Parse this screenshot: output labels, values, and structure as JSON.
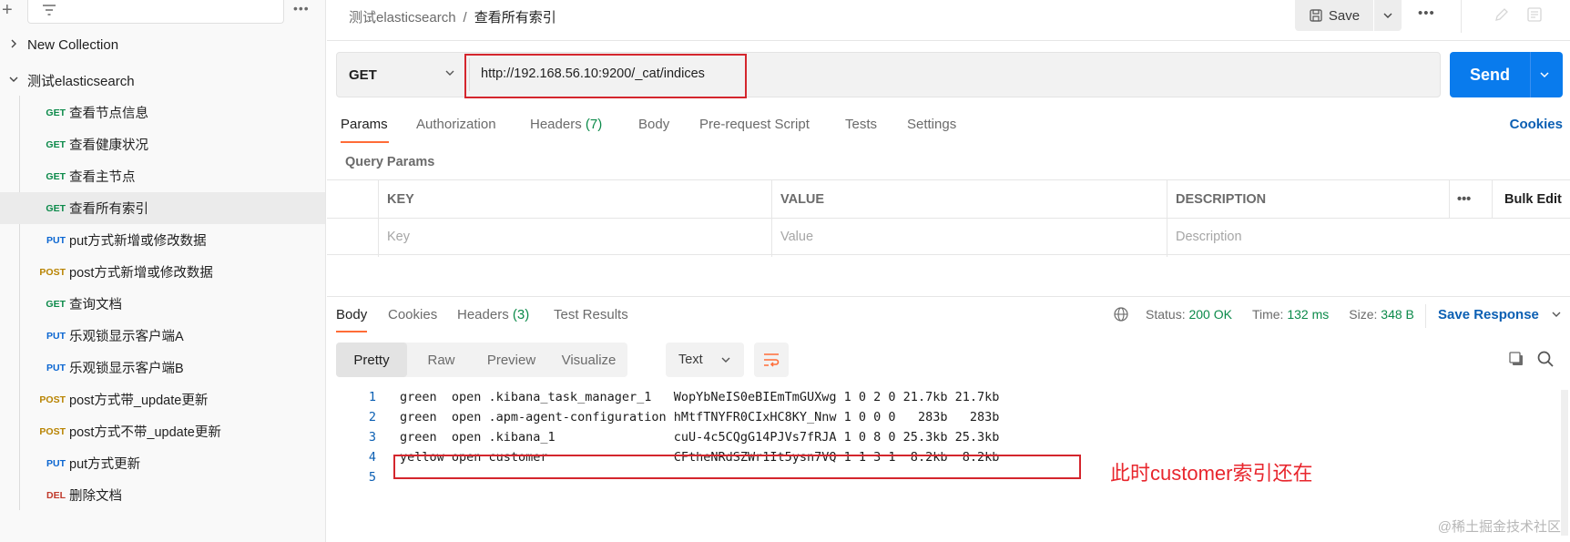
{
  "sidebar": {
    "collections": [
      {
        "name": "New Collection",
        "expanded": false
      },
      {
        "name": "测试elasticsearch",
        "expanded": true
      }
    ],
    "requests": [
      {
        "method": "GET",
        "name": "查看节点信息"
      },
      {
        "method": "GET",
        "name": "查看健康状况"
      },
      {
        "method": "GET",
        "name": "查看主节点"
      },
      {
        "method": "GET",
        "name": "查看所有索引"
      },
      {
        "method": "PUT",
        "name": "put方式新增或修改数据"
      },
      {
        "method": "POST",
        "name": "post方式新增或修改数据"
      },
      {
        "method": "GET",
        "name": "查询文档"
      },
      {
        "method": "PUT",
        "name": "乐观锁显示客户端A"
      },
      {
        "method": "PUT",
        "name": "乐观锁显示客户端B"
      },
      {
        "method": "POST",
        "name": "post方式带_update更新"
      },
      {
        "method": "POST",
        "name": "post方式不带_update更新"
      },
      {
        "method": "PUT",
        "name": "put方式更新"
      },
      {
        "method": "DEL",
        "name": "删除文档"
      }
    ]
  },
  "header": {
    "breadcrumb_collection": "测试elasticsearch",
    "breadcrumb_separator": "/",
    "breadcrumb_request": "查看所有索引",
    "save_label": "Save"
  },
  "request": {
    "method": "GET",
    "url": "http://192.168.56.10:9200/_cat/indices",
    "send_label": "Send"
  },
  "request_tabs": {
    "params": "Params",
    "authorization": "Authorization",
    "headers": "Headers",
    "headers_count": "(7)",
    "body": "Body",
    "prerequest": "Pre-request Script",
    "tests": "Tests",
    "settings": "Settings",
    "cookies": "Cookies"
  },
  "query_params": {
    "title": "Query Params",
    "col_key": "KEY",
    "col_value": "VALUE",
    "col_description": "DESCRIPTION",
    "bulk_edit": "Bulk Edit",
    "ph_key": "Key",
    "ph_value": "Value",
    "ph_description": "Description"
  },
  "response_tabs": {
    "body": "Body",
    "cookies": "Cookies",
    "headers": "Headers",
    "headers_count": "(3)",
    "test_results": "Test Results"
  },
  "response_status": {
    "status_label": "Status:",
    "status_value": "200 OK",
    "time_label": "Time:",
    "time_value": "132 ms",
    "size_label": "Size:",
    "size_value": "348 B",
    "save_response": "Save Response"
  },
  "view": {
    "pretty": "Pretty",
    "raw": "Raw",
    "preview": "Preview",
    "visualize": "Visualize",
    "format": "Text"
  },
  "code_lines": [
    {
      "n": "1",
      "text": "green  open .kibana_task_manager_1   WopYbNeIS0eBIEmTmGUXwg 1 0 2 0 21.7kb 21.7kb"
    },
    {
      "n": "2",
      "text": "green  open .apm-agent-configuration hMtfTNYFR0CIxHC8KY_Nnw 1 0 0 0   283b   283b"
    },
    {
      "n": "3",
      "text": "green  open .kibana_1                cuU-4c5CQgG14PJVs7fRJA 1 0 8 0 25.3kb 25.3kb"
    },
    {
      "n": "4",
      "text": "yellow open customer                 CFtheNRdSZWr1It5ysn7VQ 1 1 3 1  8.2kb  8.2kb"
    },
    {
      "n": "5",
      "text": ""
    }
  ],
  "annotation": "此时customer索引还在",
  "watermark": "@稀土掘金技术社区",
  "colors": {
    "accent": "#ff6c37",
    "send": "#097bed",
    "highlight": "#d4262d",
    "get": "#0c8a4a",
    "put": "#0b66d1",
    "post": "#b88300",
    "del": "#c0392b"
  }
}
